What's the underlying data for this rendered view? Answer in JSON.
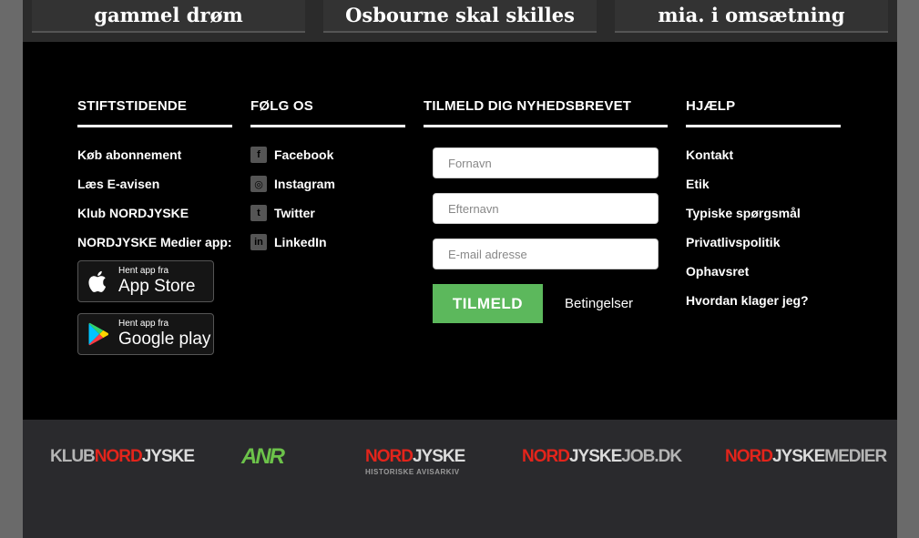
{
  "teasers": [
    "gammel drøm",
    "Osbourne skal skilles",
    "mia. i omsætning"
  ],
  "stiftstidende": {
    "title": "STIFTSTIDENDE",
    "links": [
      "Køb abonnement",
      "Læs E-avisen",
      "Klub NORDJYSKE"
    ],
    "app_label": "NORDJYSKE Medier app:",
    "appstore": {
      "small": "Hent app fra",
      "big": "App Store"
    },
    "googleplay": {
      "small": "Hent app fra",
      "big": "Google play"
    }
  },
  "follow": {
    "title": "FØLG OS",
    "links": [
      "Facebook",
      "Instagram",
      "Twitter",
      "LinkedIn"
    ]
  },
  "newsletter": {
    "title": "TILMELD DIG NYHEDSBREVET",
    "firstname_placeholder": "Fornavn",
    "lastname_placeholder": "Efternavn",
    "email_placeholder": "E-mail adresse",
    "submit_label": "TILMELD",
    "terms_label": "Betingelser",
    "submit_color": "#5cb85c"
  },
  "help": {
    "title": "HJÆLP",
    "links": [
      "Kontakt",
      "Etik",
      "Typiske spørgsmål",
      "Privatlivspolitik",
      "Ophavsret",
      "Hvordan klager jeg?"
    ]
  },
  "partners": {
    "klub": {
      "a": "KLUB",
      "b": "NORD",
      "c": "JYSKE"
    },
    "anr": "ANR",
    "arkiv": {
      "a": "NORD",
      "b": "JYSKE",
      "sub": "HISTORISKE AVISARKIV"
    },
    "job": {
      "a": "NORD",
      "b": "JYSKE",
      "c": "JOB.DK"
    },
    "medier": {
      "a": "NORD",
      "b": "JYSKE",
      "c": "MEDIER"
    }
  },
  "colors": {
    "brand_red": "#e3241b",
    "anr_green": "#6cc24a",
    "footer_bg": "#000000"
  }
}
